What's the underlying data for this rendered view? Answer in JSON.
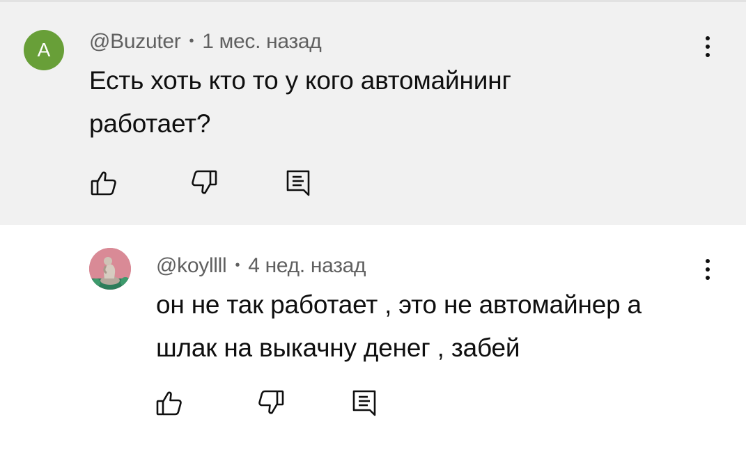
{
  "comment": {
    "avatar_letter": "A",
    "avatar_color": "#689f38",
    "author": "@Buzuter",
    "separator": "•",
    "time": "1 мес. назад",
    "text_line1": "Есть хоть кто то у кого автомайнинг",
    "text_line2": "работает?",
    "actions": {
      "like": "thumb-up-icon",
      "dislike": "thumb-down-icon",
      "reply": "comment-icon"
    }
  },
  "reply": {
    "author": "@koyllll",
    "separator": "•",
    "time": "4 нед. назад",
    "text_line1": "он не так работает , это не автомайнер а",
    "text_line2": "шлак на выкачну денег , забей",
    "actions": {
      "like": "thumb-up-icon",
      "dislike": "thumb-down-icon",
      "reply": "comment-icon"
    }
  },
  "colors": {
    "highlight_bg": "#f1f1f1",
    "meta_text": "#606060",
    "body_text": "#0f0f0f"
  }
}
